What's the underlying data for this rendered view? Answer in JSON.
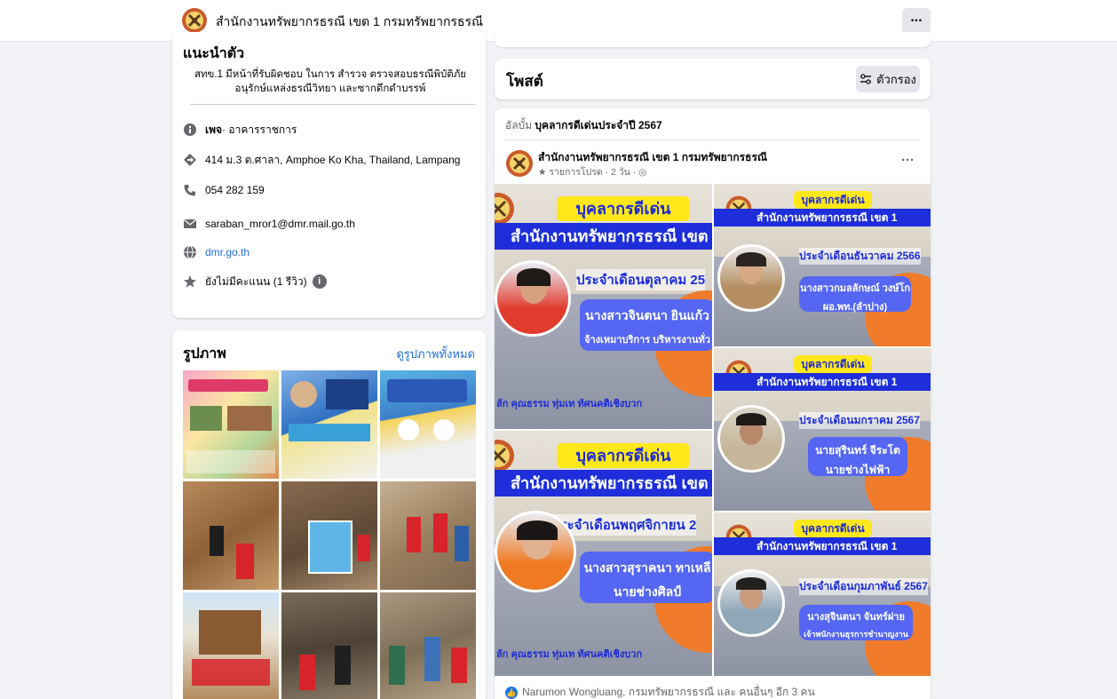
{
  "header": {
    "page_name": "สำนักงานทรัพยากรธรณี เขต 1 กรมทรัพยากรธรณี",
    "more_label": "..."
  },
  "intro": {
    "title": "แนะนำตัว",
    "description": "สทข.1 มีหน้าที่รับผิดชอบ ในการ สำรวจ ตรวจสอบธรณีพิบัติภัย อนุรักษ์แหล่งธรณีวิทยา และซากดึกดำบรรพ์",
    "category_prefix": "เพจ",
    "category": " · อาคารราชการ",
    "address": "414 ม.3 ต.ศาลา, Amphoe Ko Kha, Thailand, Lampang",
    "phone": "054 282 159",
    "email": "saraban_mror1@dmr.mail.go.th",
    "website": "dmr.go.th",
    "rating": "ยังไม่มีคะแนน (1 รีวิว)"
  },
  "photos": {
    "title": "รูปภาพ",
    "see_all": "ดูรูปภาพทั้งหมด"
  },
  "posts": {
    "title": "โพสต์",
    "filter_label": "ตัวกรอง"
  },
  "post": {
    "album_prefix": "อัลบั้ม ",
    "album_name": "บุคลากรดีเด่นประจำปี 2567",
    "author": "สำนักงานทรัพยากรธรณี เขต 1 กรมทรัพยากรธรณี",
    "meta": "★ รายการโปรด · 2 วัน · ◎",
    "more_label": "···",
    "reactions": "Narumon Wongluang, กรมทรัพยากรธรณี และ คนอื่นๆ อีก 3 คน"
  },
  "tiles": {
    "heading": "บุคลากรดีเด่น",
    "office": "สำนักงานทรัพยากรธรณี เขต 1",
    "footer": "ลัก คุณธรรม ทุ่มเท ทัศนคติเชิงบวก",
    "t1": {
      "month": "ประจำเดือนตุลาคม 25",
      "name": "นางสาวจินตนา ยินแก้ว",
      "role": "จ้างเหมาบริการ บริหารงานทั่ว"
    },
    "t2": {
      "month": "ประจำเดือนธันวาคม 2566",
      "name": "นางสาวกมลลักษณ์ วงษ์โก",
      "role": "ผอ.พท.(ลำปาง)"
    },
    "t3": {
      "month": "ประจำเดือนมกราคม 2567",
      "name": "นายสุรินทร์ จีระโต",
      "role": "นายช่างไฟฟ้า"
    },
    "t4": {
      "month": "ประจำเดือนพฤศจิกายน 2",
      "name": "นางสาวสุราคนา ทาเหลี",
      "role": "นายช่างศิลป์"
    },
    "t5": {
      "month": "ประจำเดือนกุมภาพันธ์ 2567",
      "name": "นางสุจินตนา จันทร์ฝาย",
      "role": "เจ้าพนักงานธุรการชำนาญงาน"
    }
  },
  "colors": {
    "accent": "#1b74e4",
    "link": "#216fdb",
    "badge_yellow": "#ffe81a",
    "band_blue": "#1e2edb",
    "orange": "#f07b2a"
  }
}
